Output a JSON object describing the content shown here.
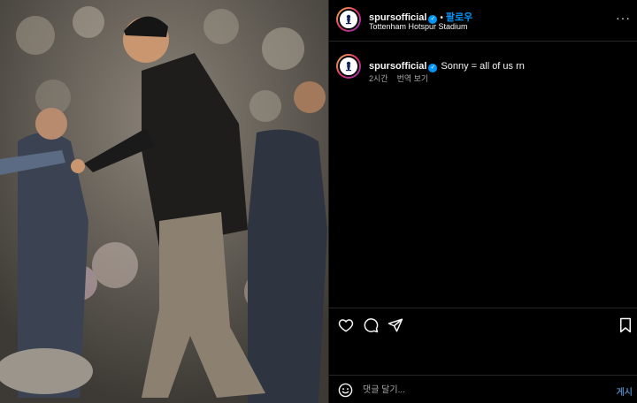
{
  "header": {
    "username": "spursofficial",
    "follow_label": "팔로우",
    "separator": "•",
    "location": "Tottenham Hotspur Stadium",
    "more_label": "···"
  },
  "caption": {
    "username": "spursofficial",
    "text": "Sonny = all of us rn",
    "time": "2시간",
    "translate_label": "번역 보기"
  },
  "comment": {
    "placeholder": "댓글 달기...",
    "post_label": "게시"
  },
  "icons": {
    "header_avatar": "spurs-crest-icon",
    "like": "heart-icon",
    "comment": "comment-bubble-icon",
    "share": "paper-plane-icon",
    "save": "bookmark-icon",
    "emoji": "smiley-icon"
  },
  "colors": {
    "accent": "#0095f6",
    "background": "#000000",
    "muted_text": "#a8a8a8"
  }
}
